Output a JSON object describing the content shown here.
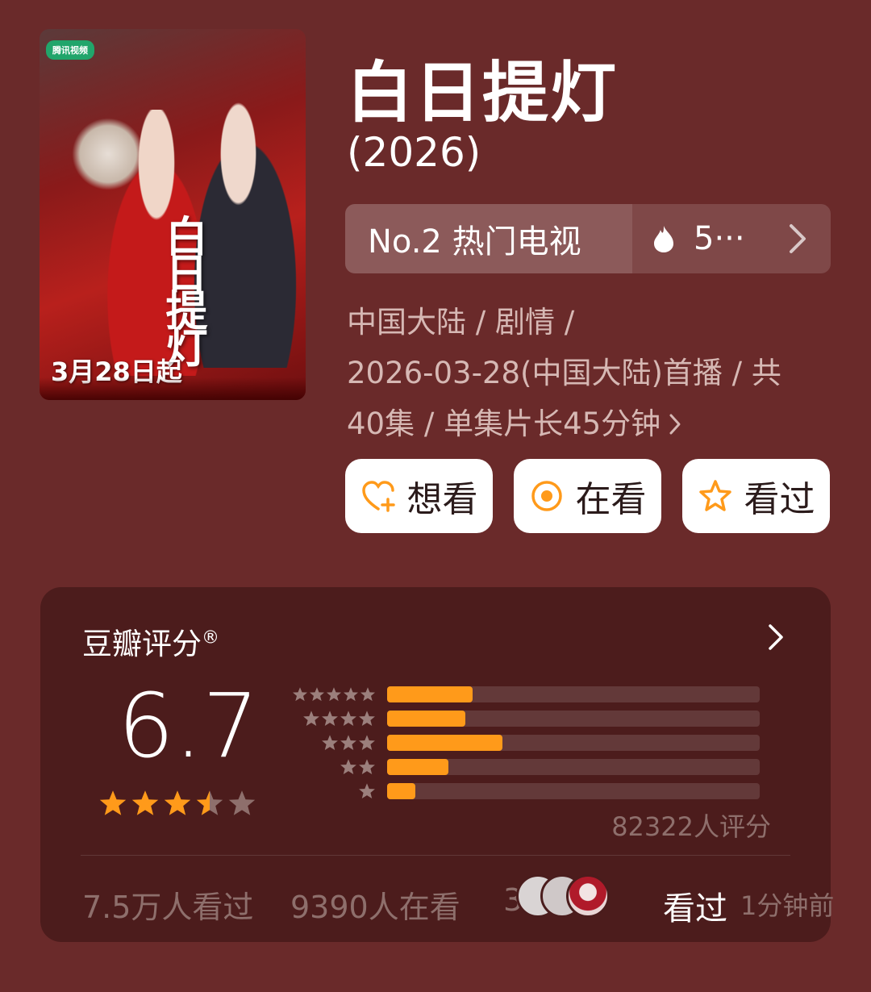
{
  "poster": {
    "logo_text": "腾讯视频",
    "calligraphy": "白日提灯",
    "date_text": "3月28日起"
  },
  "title": "白日提灯",
  "year": "(2026)",
  "rank": {
    "label": "No.2 热门电视",
    "heat": "5···"
  },
  "meta": {
    "line1": "中国大陆 / 剧情 /",
    "line2": "2026-03-28(中国大陆)首播 / 共",
    "line3": "40集 / 单集片长45分钟"
  },
  "actions": {
    "want": "想看",
    "watching": "在看",
    "watched": "看过"
  },
  "rating": {
    "title": "豆瓣评分",
    "registered": "®",
    "score": "6.7",
    "stars": 3.5,
    "distribution": [
      {
        "stars": 5,
        "fraction": 0.23
      },
      {
        "stars": 4,
        "fraction": 0.21
      },
      {
        "stars": 3,
        "fraction": 0.31
      },
      {
        "stars": 2,
        "fraction": 0.165
      },
      {
        "stars": 1,
        "fraction": 0.075
      }
    ],
    "count": "82322人评分"
  },
  "stats": {
    "watched": "7.5万人看过",
    "watching": "9390人在看",
    "want": "3",
    "activity_action": "看过",
    "activity_time": "1分钟前"
  },
  "colors": {
    "background": "#6a2a2a",
    "accent": "#ff9a1a",
    "muted_text": "#8e6f6c"
  }
}
